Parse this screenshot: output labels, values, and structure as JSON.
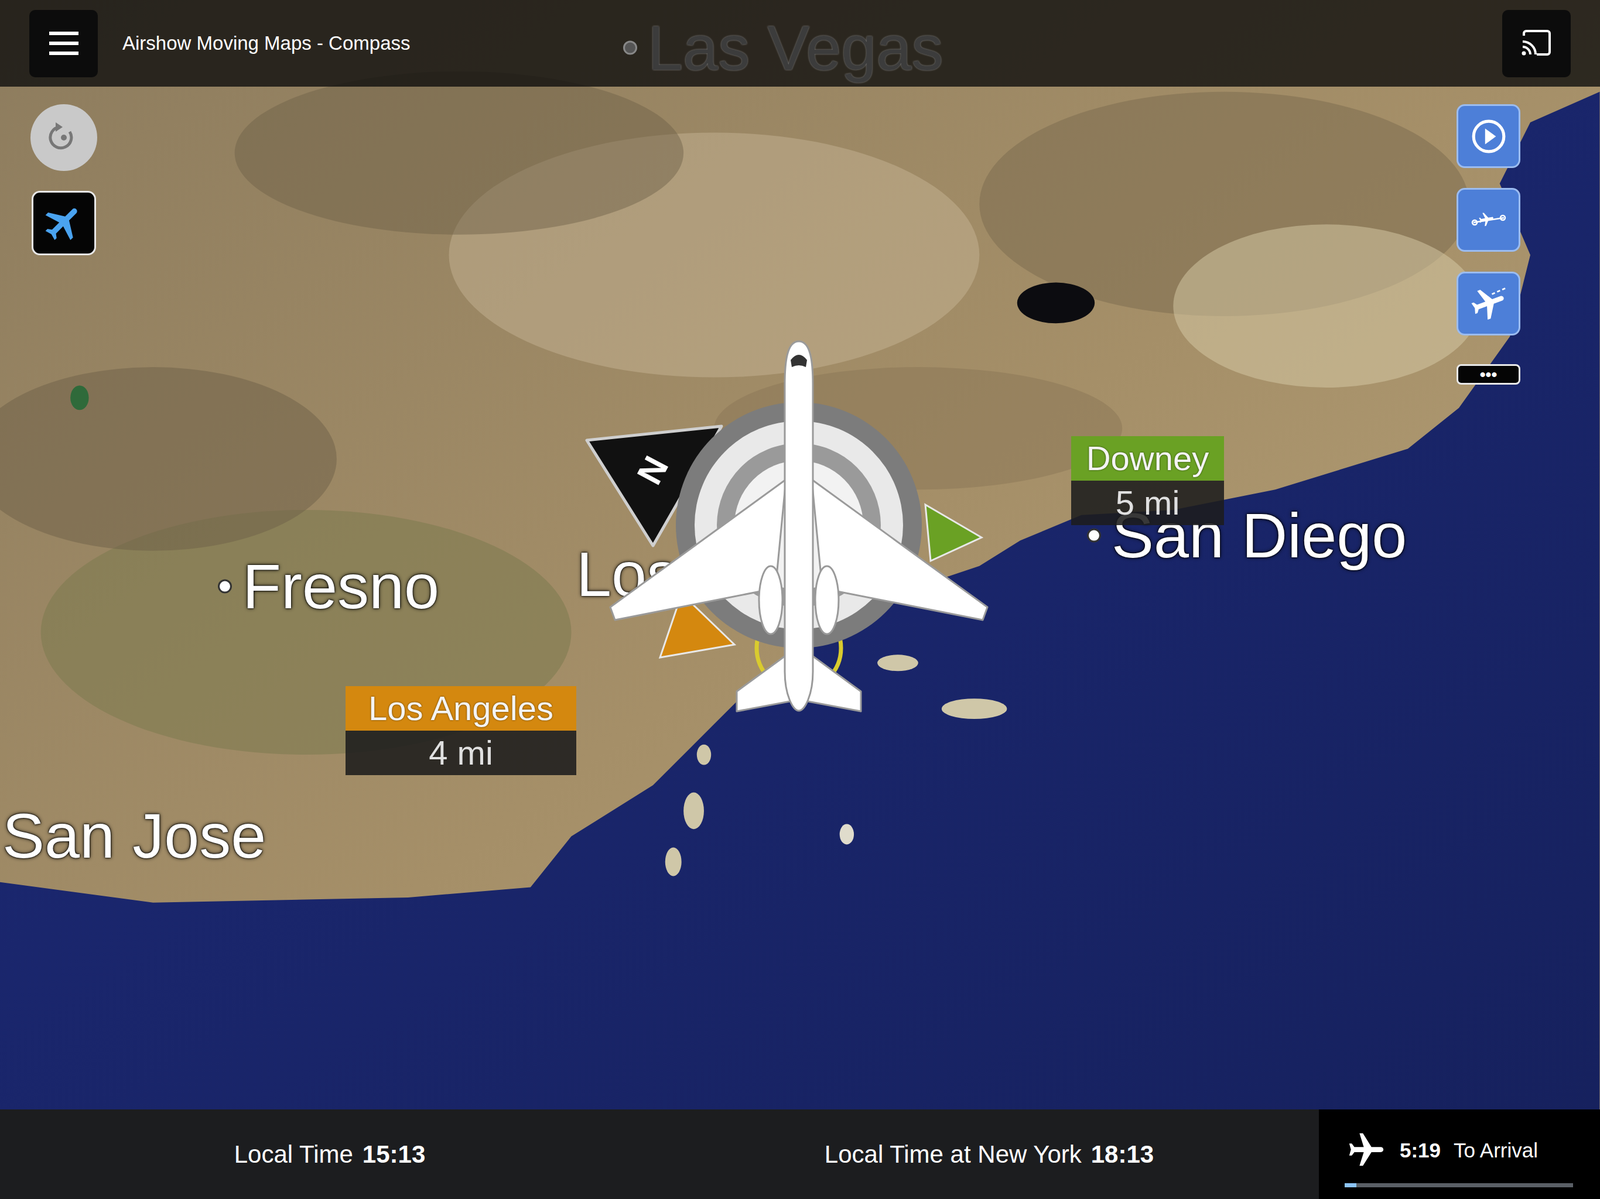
{
  "app": {
    "title": "Airshow Moving Maps - Compass",
    "more": "•••"
  },
  "cities": [
    {
      "name": "Las Vegas"
    },
    {
      "name": "Fresno"
    },
    {
      "name": "Los Angeles"
    },
    {
      "name": "San Diego"
    },
    {
      "name": "San Jose"
    }
  ],
  "compass": {
    "north": "N"
  },
  "markers": [
    {
      "name": "Downey",
      "distance": "5 mi",
      "color": "#6aa124"
    },
    {
      "name": "Los Angeles",
      "distance": "4 mi",
      "color": "#d4880f"
    }
  ],
  "status_bar": {
    "local_time_label": "Local Time",
    "local_time": "15:13",
    "remote_time_label": "Local Time at New York",
    "remote_time": "18:13",
    "time_to_arrival": "5:19",
    "arrival_label": "To Arrival",
    "level": 0.05
  }
}
